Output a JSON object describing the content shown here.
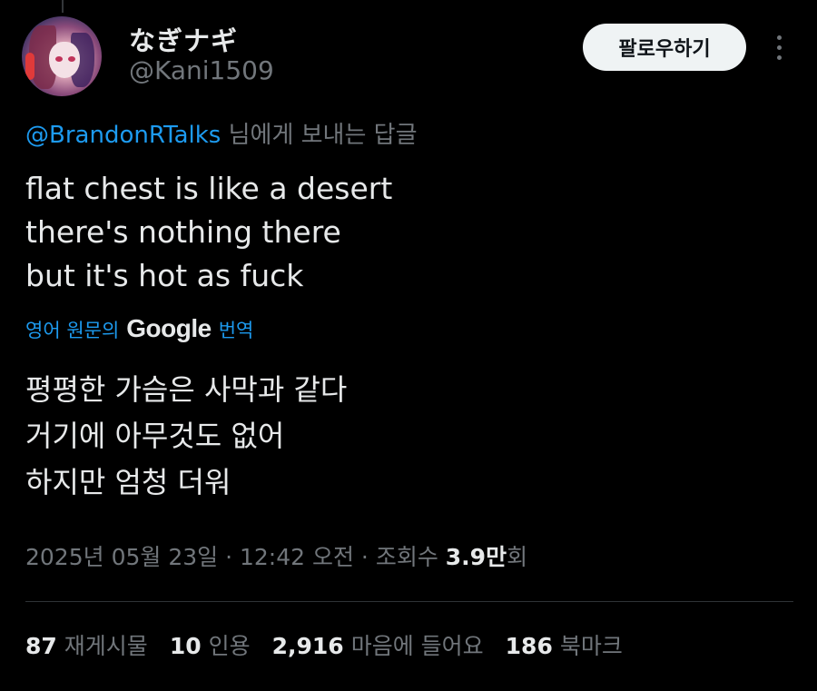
{
  "author": {
    "display_name": "なぎナギ",
    "handle": "@Kani1509"
  },
  "follow_button_label": "팔로우하기",
  "reply_to": {
    "mention": "@BrandonRTalks",
    "suffix": " 님에게 보내는 답글"
  },
  "tweet": {
    "lines": [
      "flat chest is like a desert",
      "there's nothing there",
      "but it's hot as fuck"
    ]
  },
  "translation": {
    "prefix": "영어 원문의",
    "provider": "Google",
    "suffix": "번역",
    "lines": [
      "평평한 가슴은 사막과 같다",
      "거기에 아무것도 없어",
      "하지만 엄청 더워"
    ]
  },
  "meta": {
    "date": "2025년 05월 23일",
    "separator": " · ",
    "time": "12:42 오전",
    "views_label": "조회수 ",
    "views_count": "3.9만",
    "views_suffix": "회"
  },
  "stats": [
    {
      "num": "87",
      "label": "재게시물"
    },
    {
      "num": "10",
      "label": "인용"
    },
    {
      "num": "2,916",
      "label": "마음에 들어요"
    },
    {
      "num": "186",
      "label": "북마크"
    }
  ],
  "colors": {
    "background": "#000000",
    "text_primary": "#e7e9ea",
    "text_secondary": "#71767b",
    "accent_blue": "#1d9bf0",
    "button_bg": "#eff3f4"
  },
  "icons": {
    "more": "more-dots-vertical-icon"
  }
}
